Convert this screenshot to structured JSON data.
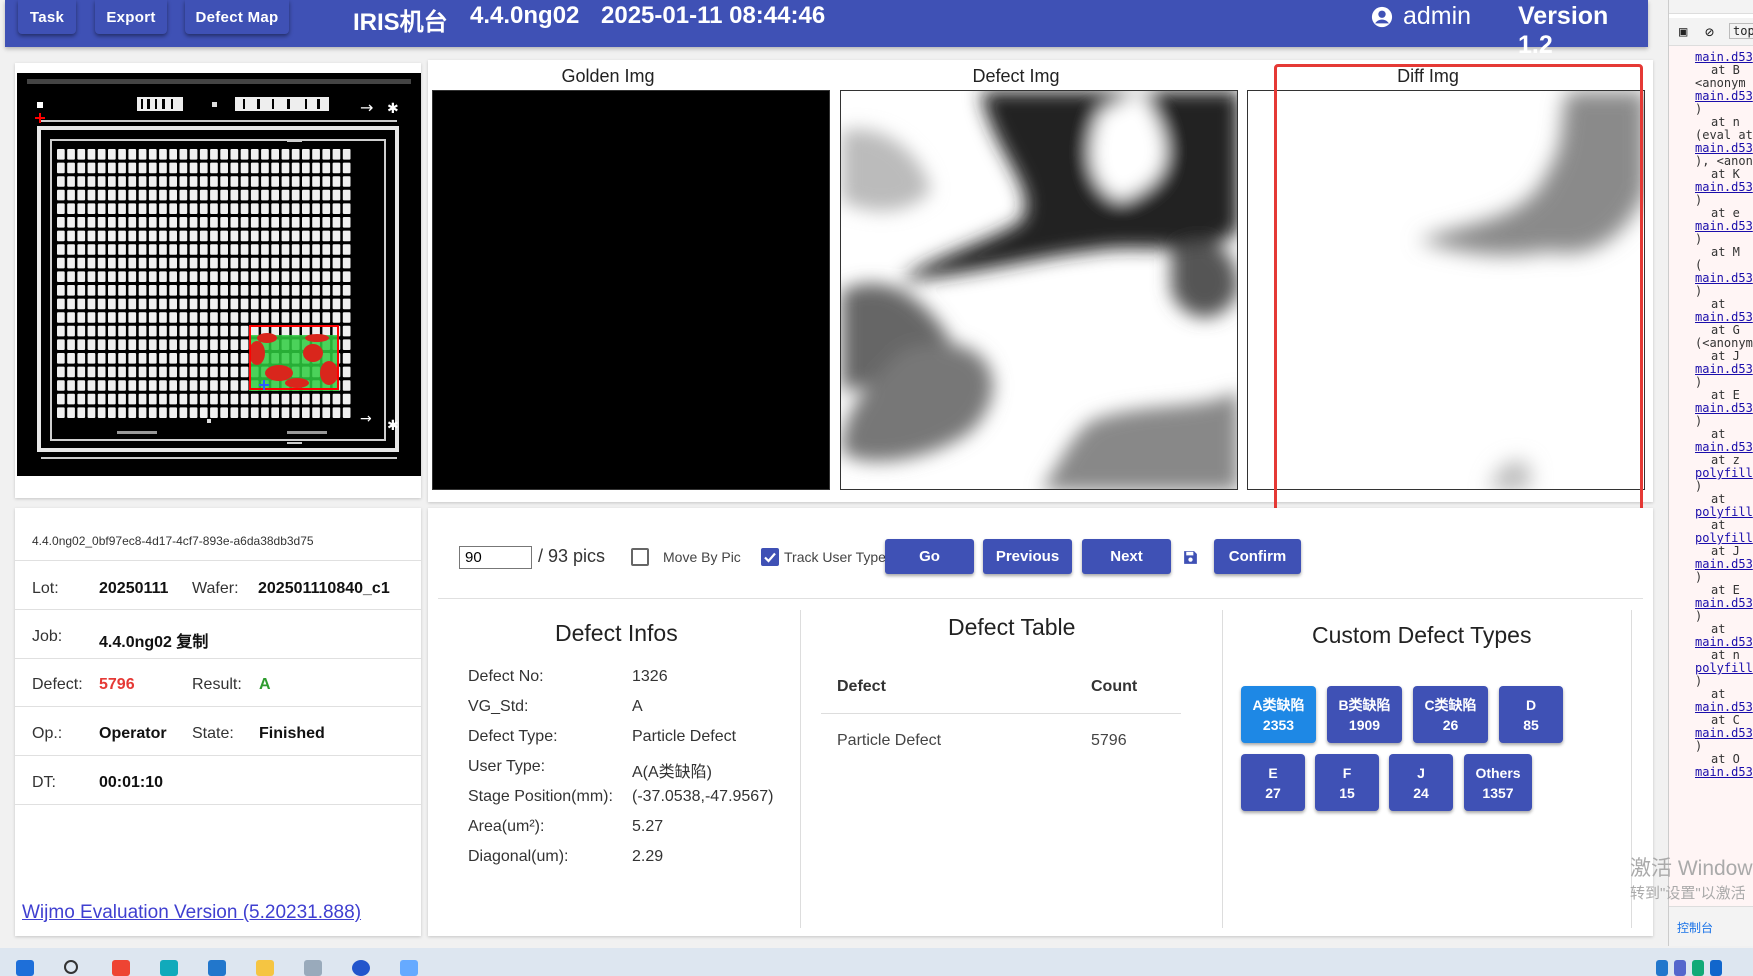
{
  "header": {
    "buttons": [
      "Task",
      "Export",
      "Defect Map"
    ],
    "title": "IRIS机台",
    "software_version": "4.4.0ng02",
    "datetime": "2025-01-11 08:44:46",
    "user": "admin",
    "version": "Version 1.2",
    "user_icon": "account-circle-icon"
  },
  "images": {
    "golden_title": "Golden Img",
    "defect_title": "Defect Img",
    "diff_title": "Diff Img"
  },
  "info": {
    "recipe": "4.4.0ng02_0bf97ec8-4d17-4cf7-893e-a6da38db3d75",
    "lot_label": "Lot:",
    "lot": "20250111",
    "wafer_label": "Wafer:",
    "wafer": "202501110840_c1",
    "job_label": "Job:",
    "job": "4.4.0ng02 复制",
    "defect_label": "Defect:",
    "defect": "5796",
    "result_label": "Result:",
    "result": "A",
    "op_label": "Op.:",
    "op": "Operator",
    "state_label": "State:",
    "state": "Finished",
    "dt_label": "DT:",
    "dt": "00:01:10",
    "wijmo": "Wijmo Evaluation Version (5.20231.888)"
  },
  "controls": {
    "page_value": "90",
    "page_total": "/ 93 pics",
    "move_by_pic": "Move By Pic",
    "move_by_pic_checked": false,
    "track_user_type": "Track User Type",
    "track_user_type_checked": true,
    "go": "Go",
    "previous": "Previous",
    "next": "Next",
    "save_icon": "save-icon",
    "confirm": "Confirm"
  },
  "defect_infos": {
    "title": "Defect Infos",
    "rows": [
      {
        "label": "Defect No:",
        "value": "1326"
      },
      {
        "label": "VG_Std:",
        "value": "A"
      },
      {
        "label": "Defect Type:",
        "value": "Particle Defect"
      },
      {
        "label": "User Type:",
        "value": "A(A类缺陷)"
      },
      {
        "label": "Stage Position(mm):",
        "value": "(-37.0538,-47.9567)"
      },
      {
        "label": "Area(um²):",
        "value": "5.27"
      },
      {
        "label": "Diagonal(um):",
        "value": "2.29"
      }
    ]
  },
  "defect_table": {
    "title": "Defect Table",
    "headers": [
      "Defect",
      "Count"
    ],
    "rows": [
      [
        "Particle Defect",
        "5796"
      ]
    ]
  },
  "custom_types": {
    "title": "Custom Defect Types",
    "items": [
      {
        "name": "A类缺陷",
        "count": "2353"
      },
      {
        "name": "B类缺陷",
        "count": "1909"
      },
      {
        "name": "C类缺陷",
        "count": "26"
      },
      {
        "name": "D",
        "count": "85"
      },
      {
        "name": "E",
        "count": "27"
      },
      {
        "name": "F",
        "count": "15"
      },
      {
        "name": "J",
        "count": "24"
      },
      {
        "name": "Others",
        "count": "1357"
      }
    ]
  },
  "devtools": {
    "tab": "top",
    "console_tab": "控制台",
    "lines": [
      "main.d53",
      "at B",
      "<anonym",
      "main.d53",
      ")",
      "at n",
      "(eval at",
      "main.d53",
      "), <anony",
      "at K",
      "main.d53",
      ")",
      "at e",
      "main.d53",
      ")",
      "at M",
      "(",
      "main.d53",
      ")",
      "at",
      "main.d53",
      "at G",
      "(<anonym",
      "at J",
      "main.d53",
      ")",
      "at E",
      "main.d53",
      ")",
      "at",
      "main.d53",
      "at z",
      "polyfill",
      ")",
      "at",
      "polyfill",
      "at",
      "polyfill",
      "at J",
      "main.d53",
      ")",
      "at E",
      "main.d53",
      ")",
      "at",
      "main.d53",
      "at n",
      "polyfill",
      ")",
      "at",
      "main.d53",
      "at C",
      "main.d53",
      ")",
      "at O",
      "main.d53"
    ]
  },
  "watermark": {
    "line1": "激活 Window",
    "line2": "转到\"设置\"以激活"
  }
}
